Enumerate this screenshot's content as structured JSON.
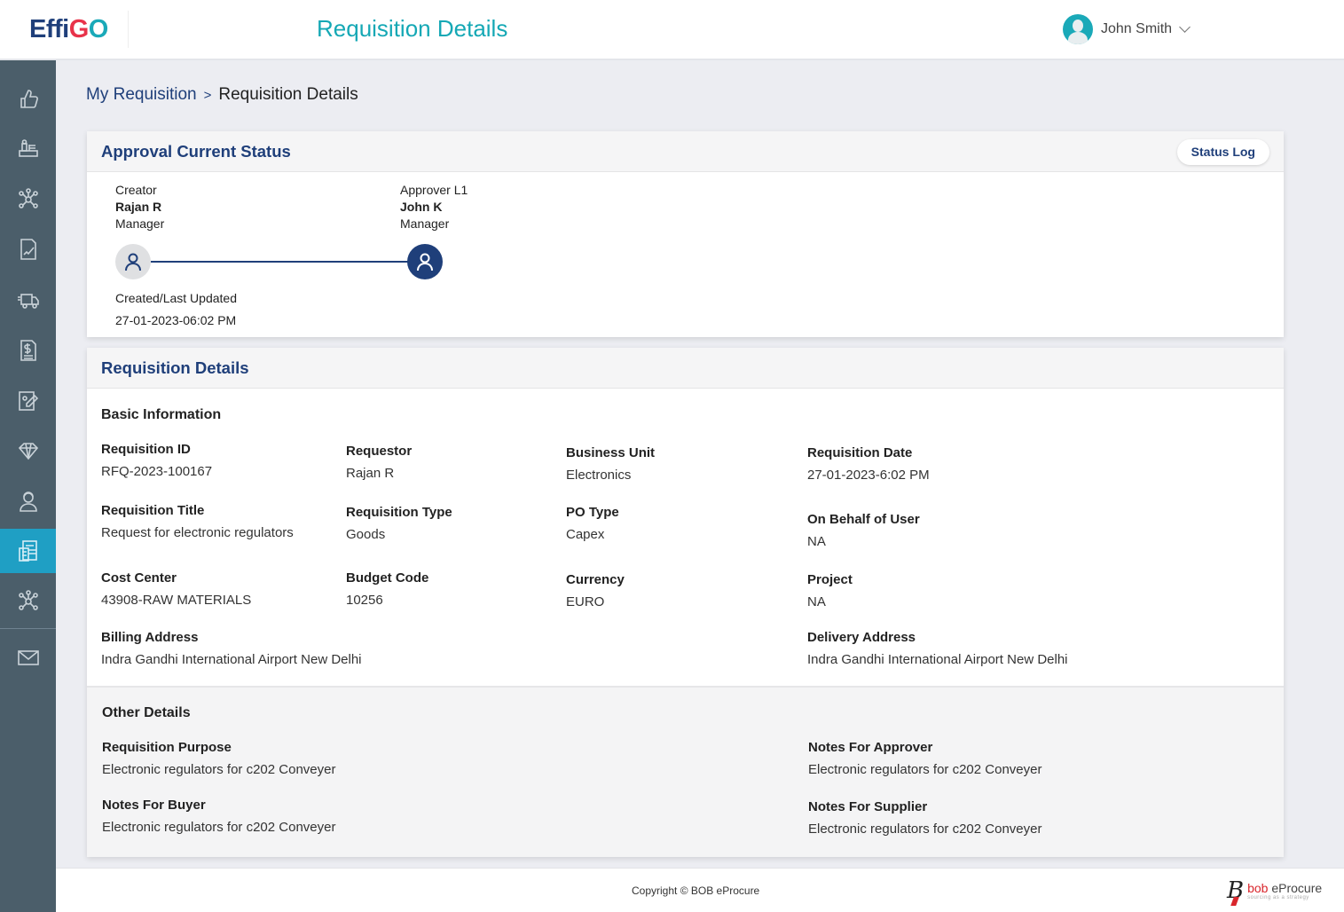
{
  "header": {
    "logo": {
      "part1": "Effi",
      "part2": "G",
      "part3": "O"
    },
    "title": "Requisition Details",
    "user_name": "John Smith"
  },
  "sidebar": {
    "items": [
      {
        "icon": "thumbs-up-icon",
        "active": false
      },
      {
        "icon": "office-desk-icon",
        "active": false
      },
      {
        "icon": "network-hub-icon",
        "active": false
      },
      {
        "icon": "signed-document-icon",
        "active": false
      },
      {
        "icon": "delivery-truck-icon",
        "active": false
      },
      {
        "icon": "invoice-dollar-icon",
        "active": false
      },
      {
        "icon": "contract-edit-icon",
        "active": false
      },
      {
        "icon": "diamond-icon",
        "active": false
      },
      {
        "icon": "support-agent-icon",
        "active": false
      },
      {
        "icon": "requisition-form-icon",
        "active": true
      },
      {
        "icon": "network-hub-icon",
        "active": false
      },
      {
        "icon": "mail-icon",
        "active": false
      }
    ]
  },
  "breadcrumb": {
    "parent": "My Requisition",
    "separator": ">",
    "current": "Requisition Details"
  },
  "approval": {
    "title": "Approval Current Status",
    "status_log_label": "Status Log",
    "creator": {
      "role": "Creator",
      "name": "Rajan R",
      "designation": "Manager"
    },
    "approver": {
      "role": "Approver L1",
      "name": "John K",
      "designation": "Manager"
    },
    "updated_label": "Created/Last Updated",
    "updated_value": "27-01-2023-06:02 PM"
  },
  "details": {
    "title": "Requisition Details",
    "basic_title": "Basic Information",
    "fields": {
      "requisition_id": {
        "label": "Requisition ID",
        "value": "RFQ-2023-100167"
      },
      "requestor": {
        "label": "Requestor",
        "value": "Rajan R"
      },
      "business_unit": {
        "label": "Business Unit",
        "value": "Electronics"
      },
      "requisition_date": {
        "label": "Requisition Date",
        "value": "27-01-2023-6:02 PM"
      },
      "requisition_title": {
        "label": "Requisition Title",
        "value": "Request for electronic regulators"
      },
      "requisition_type": {
        "label": "Requisition Type",
        "value": "Goods"
      },
      "po_type": {
        "label": "PO Type",
        "value": "Capex"
      },
      "on_behalf": {
        "label": "On Behalf of User",
        "value": "NA"
      },
      "cost_center": {
        "label": "Cost Center",
        "value": "43908-RAW MATERIALS"
      },
      "budget_code": {
        "label": "Budget Code",
        "value": "10256"
      },
      "currency": {
        "label": "Currency",
        "value": "EURO"
      },
      "project": {
        "label": "Project",
        "value": "NA"
      },
      "billing_address": {
        "label": "Billing Address",
        "value": "Indra Gandhi International Airport New Delhi"
      },
      "delivery_address": {
        "label": "Delivery Address",
        "value": "Indra Gandhi International Airport New Delhi"
      }
    },
    "other_title": "Other Details",
    "other_fields": {
      "purpose": {
        "label": "Requisition Purpose",
        "value": "Electronic regulators for c202 Conveyer"
      },
      "notes_approver": {
        "label": "Notes For Approver",
        "value": "Electronic regulators for c202 Conveyer"
      },
      "notes_buyer": {
        "label": "Notes For Buyer",
        "value": "Electronic regulators for c202 Conveyer"
      },
      "notes_supplier": {
        "label": "Notes For Supplier",
        "value": "Electronic regulators for c202 Conveyer"
      }
    }
  },
  "footer": {
    "copyright": "Copyright © BOB eProcure",
    "brand_bob": "bob",
    "brand_rest": " eProcure",
    "tagline": "sourcing as a strategy"
  },
  "colors": {
    "primary": "#1f3f7a",
    "accent": "#15a8b5",
    "sidebar_bg": "#4b5e6a",
    "sidebar_active": "#1f9fc4"
  }
}
